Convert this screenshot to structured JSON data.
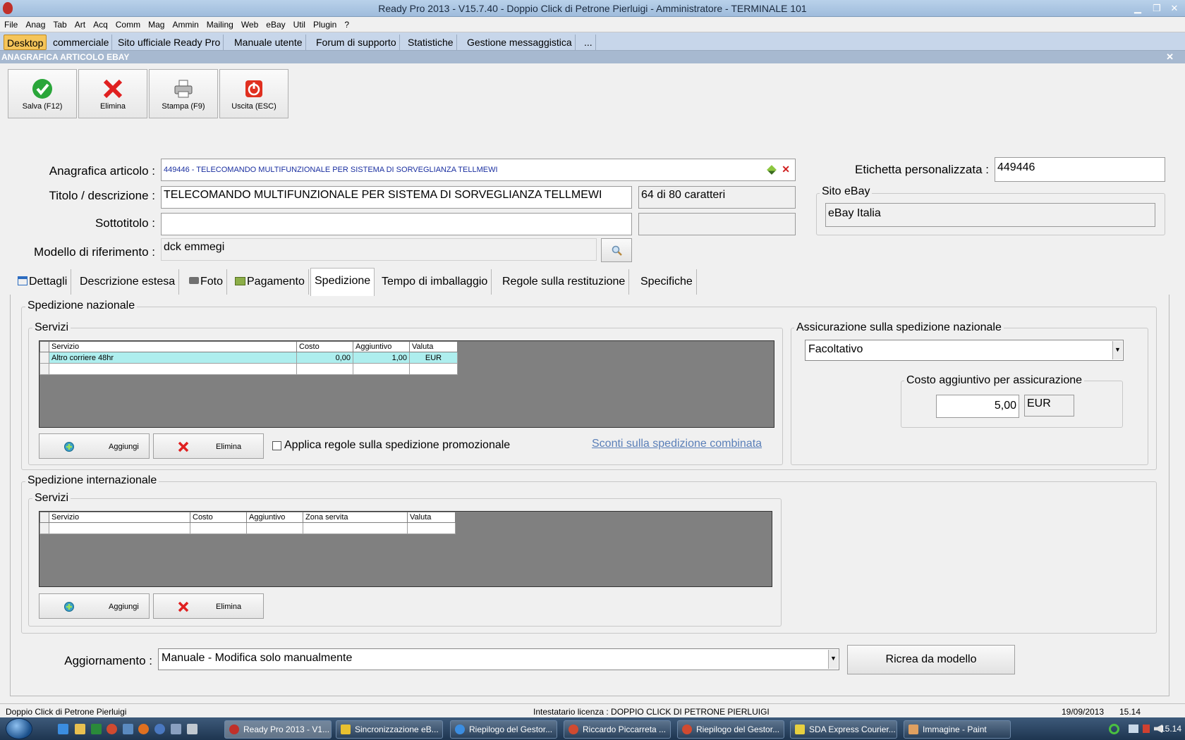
{
  "window": {
    "title": "Ready Pro 2013 - V15.7.40 - Doppio Click di Petrone Pierluigi - Amministratore - TERMINALE 101",
    "min_glyph": "▁",
    "max_glyph": "❐",
    "close_glyph": "✕"
  },
  "menu": [
    "File",
    "Anag",
    "Tab",
    "Art",
    "Acq",
    "Comm",
    "Mag",
    "Ammin",
    "Mailing",
    "Web",
    "eBay",
    "Util",
    "Plugin",
    "?"
  ],
  "desktop_tabs": [
    "Desktop",
    "commerciale",
    "Sito ufficiale Ready Pro",
    "Manuale utente",
    "Forum di supporto",
    "Statistiche",
    "Gestione messaggistica",
    "..."
  ],
  "form": {
    "title": "ANAGRAFICA ARTICOLO EBAY",
    "close": "✕"
  },
  "toolbar": {
    "save": "Salva (F12)",
    "delete": "Elimina",
    "print": "Stampa (F9)",
    "exit": "Uscita (ESC)"
  },
  "fields": {
    "articolo_label": "Anagrafica articolo :",
    "articolo_value": "449446 - TELECOMANDO MULTIFUNZIONALE PER SISTEMA DI SORVEGLIANZA TELLMEWI",
    "titolo_label": "Titolo / descrizione :",
    "titolo_value": "TELECOMANDO MULTIFUNZIONALE PER SISTEMA DI SORVEGLIANZA TELLMEWI",
    "titolo_count": "64 di 80 caratteri",
    "sottotitolo_label": "Sottotitolo :",
    "sottotitolo_value": "",
    "sottotitolo_count": "",
    "modello_label": "Modello di riferimento :",
    "modello_value": "dck emmegi",
    "etichetta_label": "Etichetta personalizzata :",
    "etichetta_value": "449446",
    "sito_label": "Sito eBay",
    "sito_value": "eBay Italia"
  },
  "tabs": [
    "Dettagli",
    "Descrizione estesa",
    "Foto",
    "Pagamento",
    "Spedizione",
    "Tempo di imballaggio",
    "Regole sulla restituzione",
    "Specifiche"
  ],
  "nazionale": {
    "title": "Spedizione nazionale",
    "servizi_title": "Servizi",
    "columns": [
      "Servizio",
      "Costo",
      "Aggiuntivo",
      "Valuta"
    ],
    "rows": [
      [
        "Altro corriere 48hr",
        "0,00",
        "1,00",
        "EUR"
      ]
    ],
    "add": "Aggiungi",
    "delete": "Elimina",
    "promo_label": "Applica regole sulla spedizione promozionale",
    "promo_checked": false,
    "link": "Sconti sulla spedizione combinata"
  },
  "assicurazione": {
    "title": "Assicurazione sulla spedizione nazionale",
    "value": "Facoltativo",
    "costo_title": "Costo aggiuntivo per assicurazione",
    "costo_value": "5,00",
    "currency": "EUR"
  },
  "internazionale": {
    "title": "Spedizione internazionale",
    "servizi_title": "Servizi",
    "columns": [
      "Servizio",
      "Costo",
      "Aggiuntivo",
      "Zona servita",
      "Valuta"
    ],
    "add": "Aggiungi",
    "delete": "Elimina"
  },
  "aggiornamento": {
    "label": "Aggiornamento :",
    "value": "Manuale - Modifica solo manualmente",
    "button": "Ricrea da modello"
  },
  "status": {
    "company": "Doppio Click di Petrone Pierluigi",
    "license": "Intestatario licenza : DOPPIO CLICK DI PETRONE PIERLUIGI",
    "date": "19/09/2013",
    "time": "15.14"
  },
  "taskbar": {
    "items": [
      "Ready Pro 2013 - V1...",
      "Sincronizzazione eB...",
      "Riepilogo del Gestor...",
      "Riccardo Piccarreta ...",
      "Riepilogo del Gestor...",
      "SDA Express Courier...",
      "Immagine - Paint"
    ],
    "clock": "15.14"
  },
  "colors": {
    "selected_row": "#aeeeee",
    "link": "#5a7fb8",
    "desktop_tab_active": "#f5c55a"
  }
}
